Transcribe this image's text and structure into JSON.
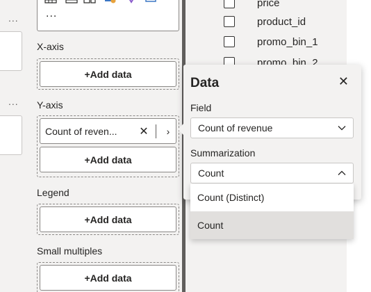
{
  "left_stub": {
    "more_label": "..."
  },
  "build_pane": {
    "gallery_more": "...",
    "sections": [
      {
        "label": "X-axis",
        "add_label": "+Add data"
      },
      {
        "label": "Y-axis",
        "add_label": "+Add data",
        "field": "Count of reven...",
        "field_remove": "✕",
        "field_expand": "›"
      },
      {
        "label": "Legend",
        "add_label": "+Add data"
      },
      {
        "label": "Small multiples",
        "add_label": "+Add data"
      }
    ]
  },
  "fields_pane": {
    "items": [
      "price",
      "product_id",
      "promo_bin_1",
      "promo_bin_2"
    ]
  },
  "data_popup": {
    "title": "Data",
    "close": "✕",
    "field_label": "Field",
    "field_value": "Count of revenue",
    "summarization_label": "Summarization",
    "summarization_value": "Count",
    "options": [
      "Count (Distinct)",
      "Count"
    ],
    "selected_option": "Count"
  },
  "colors": {
    "pane_bg": "#f3f2f1",
    "splitter": "#605e5c",
    "selected_option_bg": "#e1dfdd"
  }
}
